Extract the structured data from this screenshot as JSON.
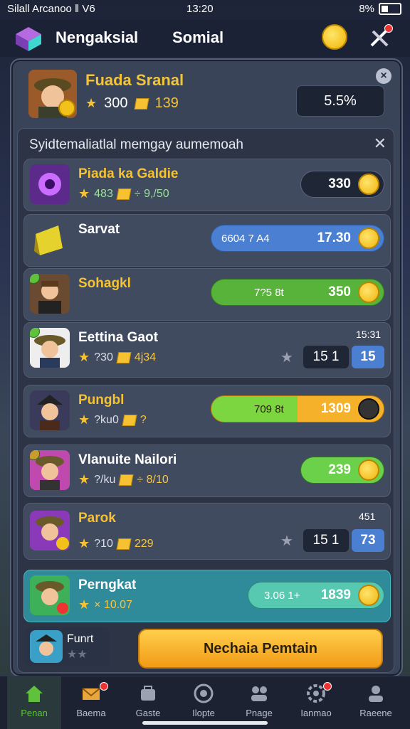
{
  "status": {
    "carrier": "Silall Arcanoo ‖ V6",
    "time": "13:20",
    "battery": "8%"
  },
  "appbar": {
    "title": "Nengaksial",
    "tab2": "Somial"
  },
  "profile": {
    "name": "Fuada Sranal",
    "stars": "300",
    "cubes": "139",
    "percent": "5.5%"
  },
  "list": {
    "heading": "Syidtemaliatlal memgay aumemoah",
    "rows": [
      {
        "name": "Piada ka Galdie",
        "stat1": "483",
        "stat2": "÷ 9,/50",
        "value": "330"
      },
      {
        "name": "Sarvat",
        "sub": "6604 7 A4",
        "value": "17.30"
      },
      {
        "name": "Sohagkl",
        "sub": "7?5 8t",
        "value": "350"
      },
      {
        "name": "Eettina Gaot",
        "stat1": "?30",
        "stat2": "4j34",
        "top": "15:31",
        "num": "15 1",
        "value": "15"
      },
      {
        "name": "Pungbl",
        "stat1": "?ku0",
        "stat2": "?",
        "sub": "709 8t",
        "value": "1309"
      },
      {
        "name": "Vlanuite Nailori",
        "stat1": "?/ku",
        "stat2": "÷ 8/10",
        "value": "239"
      },
      {
        "name": "Parok",
        "stat1": "?10",
        "stat2": "229",
        "top": "451",
        "num": "15 1",
        "value": "73"
      },
      {
        "name": "Perngkat",
        "stat1": "× 10.07",
        "sub": "3.06 1+",
        "value": "1839"
      }
    ]
  },
  "footer": {
    "name": "Funrt",
    "button": "Nechaia Pemtain"
  },
  "nav": [
    {
      "label": "Penan",
      "icon": "home-icon"
    },
    {
      "label": "Baema",
      "icon": "mail-icon"
    },
    {
      "label": "Gaste",
      "icon": "shop-icon"
    },
    {
      "label": "Ilopte",
      "icon": "target-icon"
    },
    {
      "label": "Pnage",
      "icon": "people-icon"
    },
    {
      "label": "Ianmao",
      "icon": "gear-icon"
    },
    {
      "label": "Raeene",
      "icon": "profile-icon"
    }
  ],
  "colors": {
    "accent": "#f6c232",
    "green": "#5fc13c",
    "blue": "#4a7fd1",
    "panel": "#3a4459"
  }
}
